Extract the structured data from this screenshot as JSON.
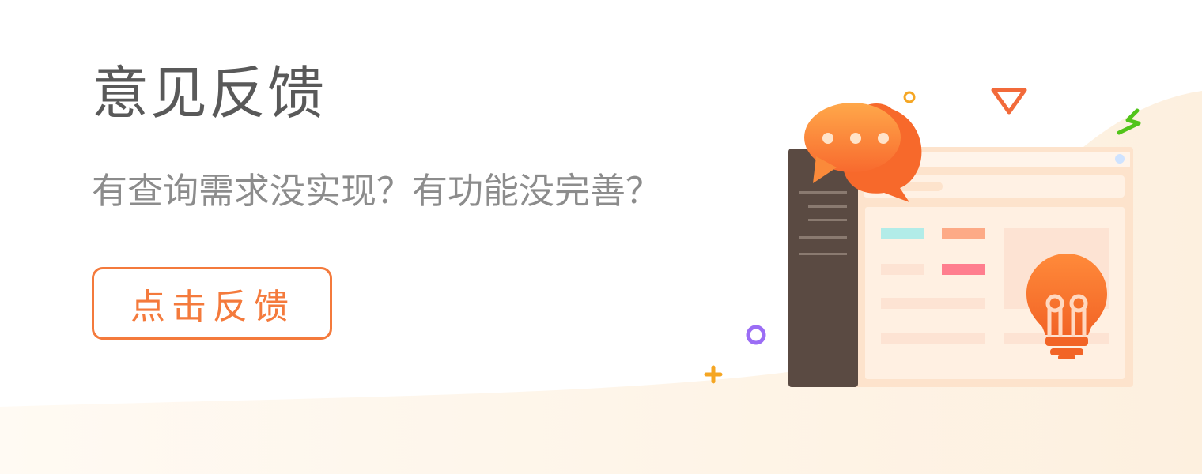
{
  "banner": {
    "title": "意见反馈",
    "subtitle": "有查询需求没实现？有功能没完善？",
    "cta_label": "点击反馈"
  },
  "illustration": {
    "icons": [
      "chat-bubble-icon",
      "lightbulb-icon",
      "browser-window-icon"
    ]
  },
  "colors": {
    "accent": "#f47a3c",
    "title": "#595959",
    "subtitle": "#8c8c8c",
    "sidebar": "#5a4a42",
    "window_bg": "#fde6d2"
  }
}
